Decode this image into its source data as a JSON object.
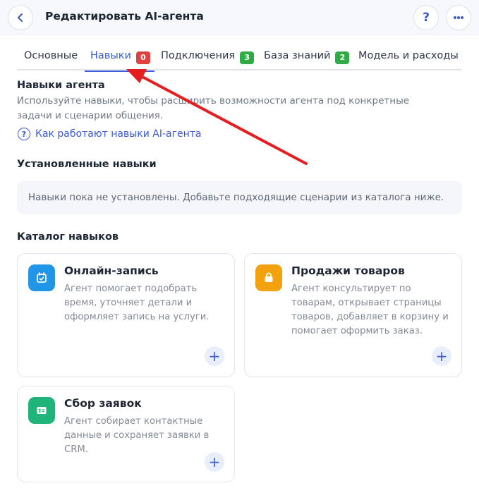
{
  "header": {
    "title": "Редактировать AI-агента",
    "help_label": "?"
  },
  "tabs": [
    {
      "label": "Основные"
    },
    {
      "label": "Навыки",
      "badge": "0",
      "badge_color": "#e33f3f"
    },
    {
      "label": "Подключения",
      "badge": "3",
      "badge_color": "#2eab45"
    },
    {
      "label": "База знаний",
      "badge": "2",
      "badge_color": "#2eab45"
    },
    {
      "label": "Модель и расходы"
    }
  ],
  "skills": {
    "title": "Навыки агента",
    "description": "Используйте навыки, чтобы расширить возможности агента под конкретные задачи и сценарии общения.",
    "help_link": "Как работают навыки AI-агента"
  },
  "installed": {
    "title": "Установленные навыки",
    "empty_text": "Навыки пока не установлены. Добавьте подходящие сценарии из каталога ниже."
  },
  "catalog": {
    "title": "Каталог навыков",
    "cards": [
      {
        "title": "Онлайн-запись",
        "text": "Агент помогает подобрать время, уточняет детали и оформляет запись на услуги.",
        "icon": "calendar-icon",
        "color": "#2196e8"
      },
      {
        "title": "Продажи товаров",
        "text": "Агент консультирует по товарам, открывает страницы товаров, добавляет в корзину и помогает оформить заказ.",
        "icon": "shopping-bag-icon",
        "color": "#f2a20c"
      },
      {
        "title": "Сбор заявок",
        "text": "Агент собирает контактные данные и сохраняет заявки в CRM.",
        "icon": "contact-card-icon",
        "color": "#1fb47a"
      }
    ]
  },
  "colors": {
    "accent": "#3b5bd6",
    "annotation_arrow": "#e41e1e"
  }
}
